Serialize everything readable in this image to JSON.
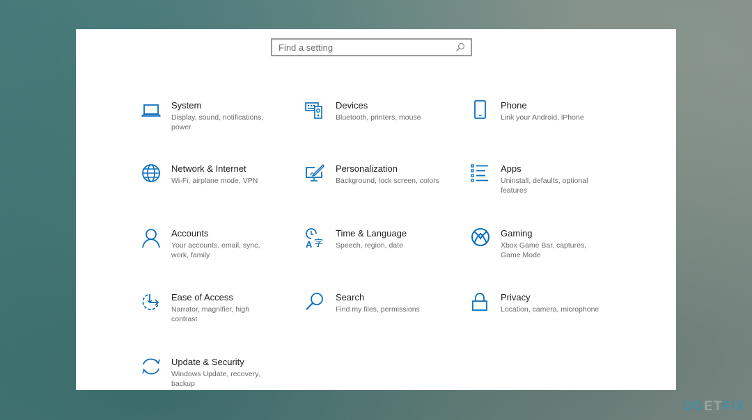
{
  "search": {
    "placeholder": "Find a setting",
    "icon": "search-icon"
  },
  "accent_color": "#0a6ebd",
  "categories": [
    {
      "title": "System",
      "description": "Display, sound, notifications, power",
      "icon": "laptop-icon"
    },
    {
      "title": "Devices",
      "description": "Bluetooth, printers, mouse",
      "icon": "keyboard-speaker-icon"
    },
    {
      "title": "Phone",
      "description": "Link your Android, iPhone",
      "icon": "phone-icon"
    },
    {
      "title": "Network & Internet",
      "description": "Wi-Fi, airplane mode, VPN",
      "icon": "globe-icon"
    },
    {
      "title": "Personalization",
      "description": "Background, lock screen, colors",
      "icon": "paintbrush-monitor-icon"
    },
    {
      "title": "Apps",
      "description": "Uninstall, defaults, optional features",
      "icon": "list-icon"
    },
    {
      "title": "Accounts",
      "description": "Your accounts, email, sync, work, family",
      "icon": "person-icon"
    },
    {
      "title": "Time & Language",
      "description": "Speech, region, date",
      "icon": "time-language-icon"
    },
    {
      "title": "Gaming",
      "description": "Xbox Game Bar, captures, Game Mode",
      "icon": "xbox-icon"
    },
    {
      "title": "Ease of Access",
      "description": "Narrator, magnifier, high contrast",
      "icon": "ease-of-access-icon"
    },
    {
      "title": "Search",
      "description": "Find my files, permissions",
      "icon": "magnifier-icon"
    },
    {
      "title": "Privacy",
      "description": "Location, camera, microphone",
      "icon": "lock-icon"
    },
    {
      "title": "Update & Security",
      "description": "Windows Update, recovery, backup",
      "icon": "sync-arrows-icon"
    }
  ],
  "watermark": {
    "part1": "UG",
    "part2": "ET",
    "part3": "FIX"
  }
}
